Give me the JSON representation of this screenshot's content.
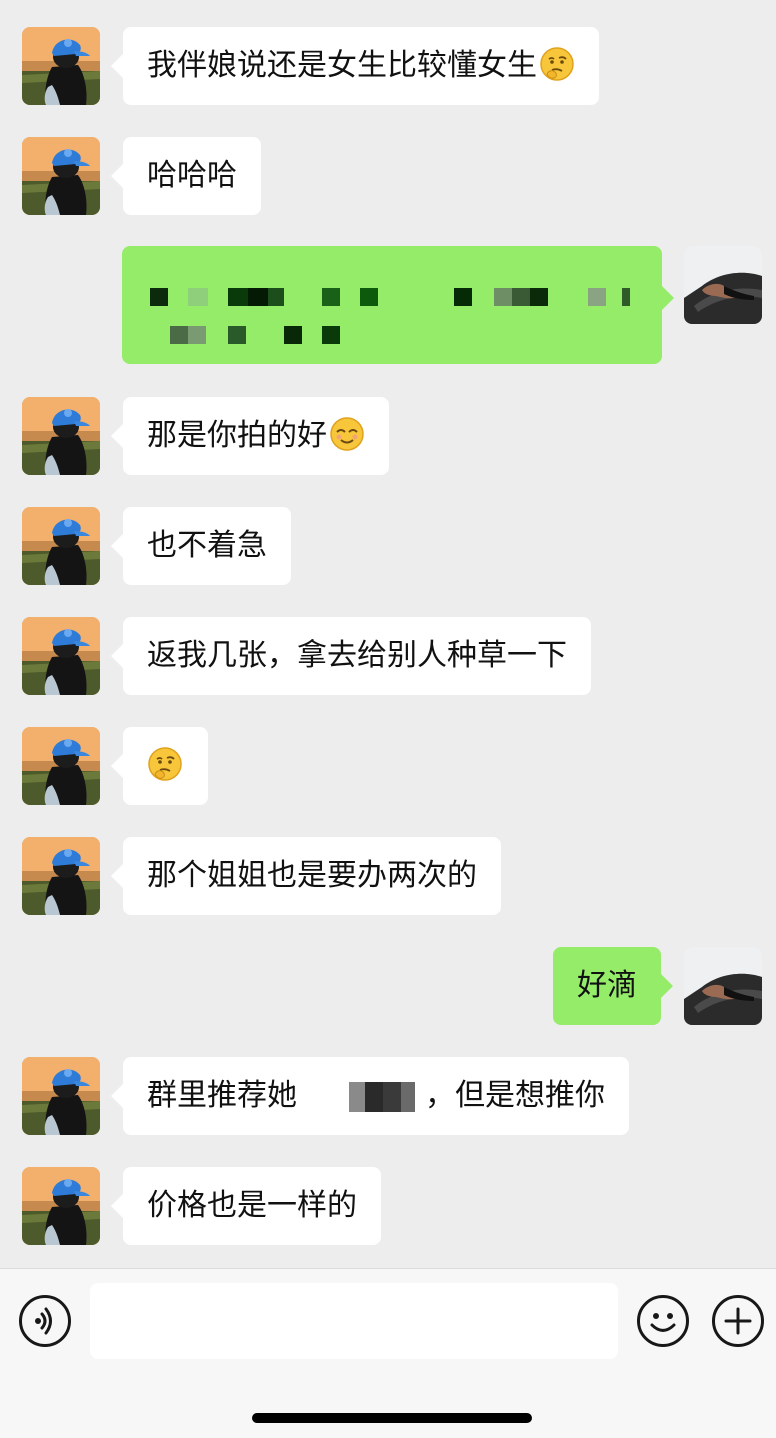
{
  "messages": [
    {
      "side": "left",
      "text": "我伴娘说还是女生比较懂女生",
      "emoji": "thinking-face"
    },
    {
      "side": "left",
      "text": "哈哈哈"
    },
    {
      "side": "right",
      "type": "redacted"
    },
    {
      "side": "left",
      "text": "那是你拍的好",
      "emoji": "relieved-face"
    },
    {
      "side": "left",
      "text": "也不着急"
    },
    {
      "side": "left",
      "text": "返我几张，拿去给别人种草一下"
    },
    {
      "side": "left",
      "text": "",
      "emoji": "thinking-face"
    },
    {
      "side": "left",
      "text": "那个姐姐也是要办两次的"
    },
    {
      "side": "right",
      "text": "好滴"
    },
    {
      "side": "left",
      "text_before": "群里推荐她",
      "text_after": "，但是想推你"
    },
    {
      "side": "left",
      "text": "价格也是一样的"
    }
  ],
  "input_bar": {
    "message_value": "",
    "voice_icon": "voice-icon",
    "emoji_icon": "emoji-icon",
    "plus_icon": "plus-icon"
  },
  "colors": {
    "background": "#ededed",
    "incoming_bubble": "#ffffff",
    "outgoing_bubble": "#95ec69"
  }
}
